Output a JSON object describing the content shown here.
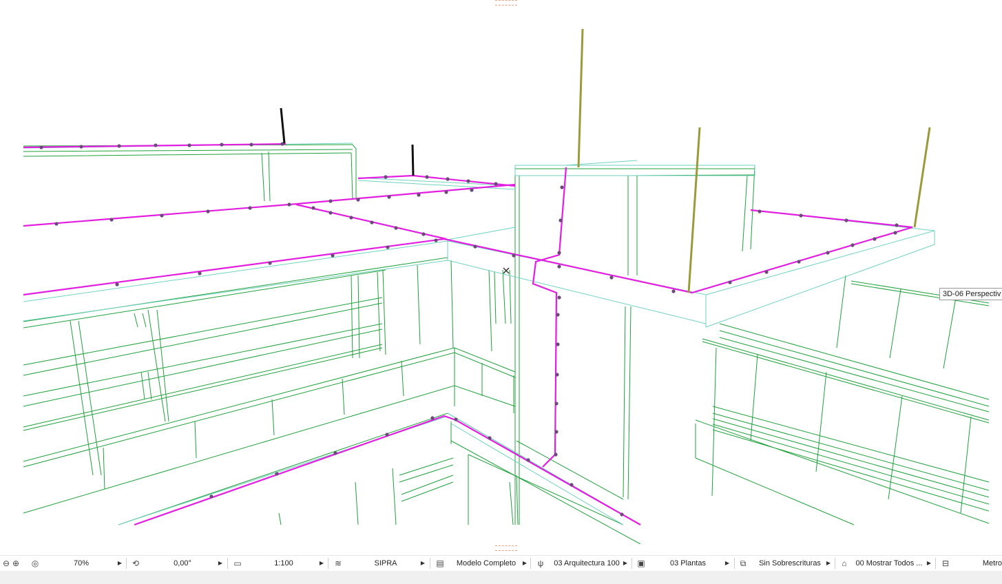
{
  "viewport": {
    "view_tag": "3D-06 Perspectiv",
    "colors": {
      "model_lines": "#1fa03a",
      "slab_edges": "#6fd2bf",
      "pipe": "#e21ee0",
      "pipe_nodes": "#6a4a78",
      "rods_olive": "#9a9a3a",
      "rods_black": "#111111"
    }
  },
  "statusbar": {
    "zoom_out_icon": "zoom-out-icon",
    "zoom_in_icon": "zoom-in-icon",
    "fit_icon": "zoom-fit-icon",
    "zoom": "70%",
    "rotation": "0,00°",
    "scale": "1:100",
    "layers": "SIPRA",
    "model_view": "Modelo Completo",
    "pen_set": "03 Arquitectura 100",
    "mvo": "03 Plantas",
    "overrides": "Sin Sobrescrituras",
    "renovation": "00 Mostrar Todos ...",
    "dimensions": "Metro"
  }
}
